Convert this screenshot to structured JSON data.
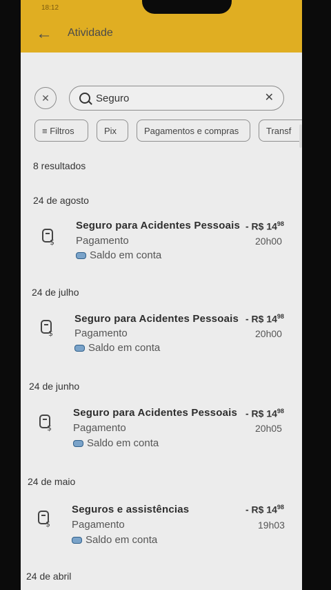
{
  "status_bar": {
    "time": "18:12"
  },
  "appbar": {
    "title": "Atividade"
  },
  "search": {
    "value": "Seguro"
  },
  "filters": [
    "Filtros",
    "Pix",
    "Pagamentos e compras",
    "Transf"
  ],
  "results_label": "8 resultados",
  "groups": [
    {
      "date": "24 de agosto",
      "title": "Seguro para Acidentes Pessoais",
      "type": "Pagamento",
      "source": "Saldo em conta",
      "amount": "- R$ 14",
      "cents": "98",
      "time": "20h00"
    },
    {
      "date": "24 de julho",
      "title": "Seguro para Acidentes Pessoais",
      "type": "Pagamento",
      "source": "Saldo em conta",
      "amount": "- R$ 14",
      "cents": "98",
      "time": "20h00"
    },
    {
      "date": "24 de junho",
      "title": "Seguro para Acidentes Pessoais",
      "type": "Pagamento",
      "source": "Saldo em conta",
      "amount": "- R$ 14",
      "cents": "98",
      "time": "20h05"
    },
    {
      "date": "24 de maio",
      "title": "Seguros e assistências",
      "type": "Pagamento",
      "source": "Saldo em conta",
      "amount": "- R$ 14",
      "cents": "98",
      "time": "19h03"
    }
  ],
  "next_date": "24 de abril"
}
